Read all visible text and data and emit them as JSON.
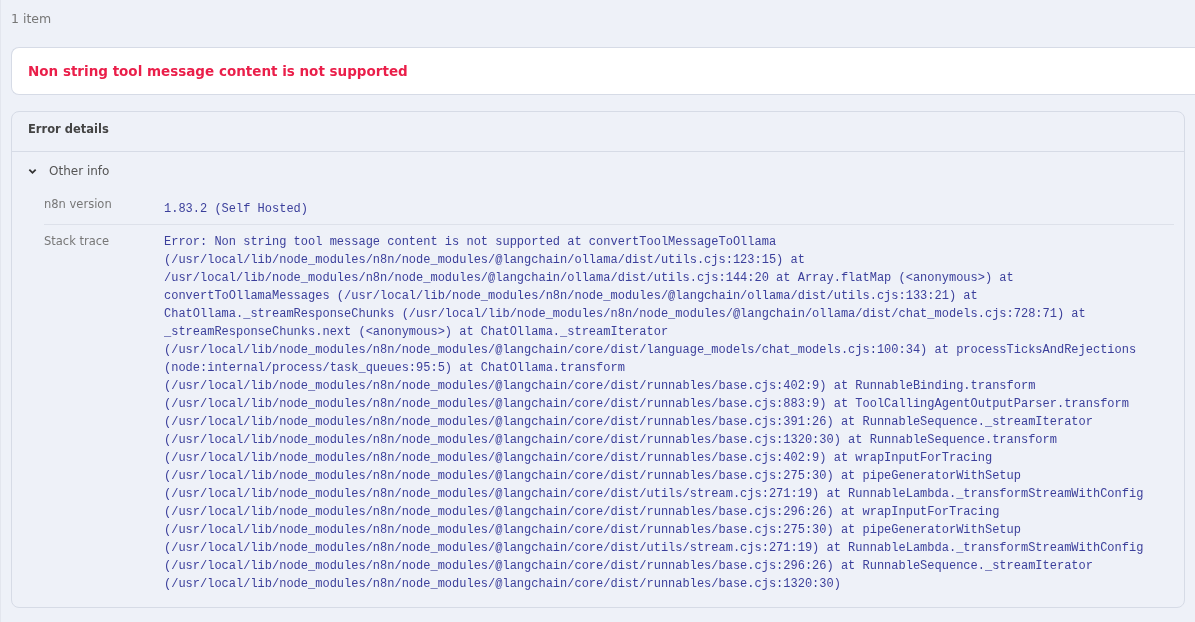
{
  "item_count": "1 item",
  "error_message": "Non string tool message content is not supported",
  "details": {
    "title": "Error details",
    "section": {
      "title": "Other info",
      "expanded": true,
      "rows": [
        {
          "label": "n8n version",
          "value": "1.83.2 (Self Hosted)"
        },
        {
          "label": "Stack trace",
          "value": "Error: Non string tool message content is not supported at convertToolMessageToOllama (/usr/local/lib/node_modules/n8n/node_modules/@langchain/ollama/dist/utils.cjs:123:15) at /usr/local/lib/node_modules/n8n/node_modules/@langchain/ollama/dist/utils.cjs:144:20 at Array.flatMap (<anonymous>) at convertToOllamaMessages (/usr/local/lib/node_modules/n8n/node_modules/@langchain/ollama/dist/utils.cjs:133:21) at ChatOllama._streamResponseChunks (/usr/local/lib/node_modules/n8n/node_modules/@langchain/ollama/dist/chat_models.cjs:728:71) at _streamResponseChunks.next (<anonymous>) at ChatOllama._streamIterator (/usr/local/lib/node_modules/n8n/node_modules/@langchain/core/dist/language_models/chat_models.cjs:100:34) at processTicksAndRejections (node:internal/process/task_queues:95:5) at ChatOllama.transform (/usr/local/lib/node_modules/n8n/node_modules/@langchain/core/dist/runnables/base.cjs:402:9) at RunnableBinding.transform (/usr/local/lib/node_modules/n8n/node_modules/@langchain/core/dist/runnables/base.cjs:883:9) at ToolCallingAgentOutputParser.transform (/usr/local/lib/node_modules/n8n/node_modules/@langchain/core/dist/runnables/base.cjs:391:26) at RunnableSequence._streamIterator (/usr/local/lib/node_modules/n8n/node_modules/@langchain/core/dist/runnables/base.cjs:1320:30) at RunnableSequence.transform (/usr/local/lib/node_modules/n8n/node_modules/@langchain/core/dist/runnables/base.cjs:402:9) at wrapInputForTracing (/usr/local/lib/node_modules/n8n/node_modules/@langchain/core/dist/runnables/base.cjs:275:30) at pipeGeneratorWithSetup (/usr/local/lib/node_modules/n8n/node_modules/@langchain/core/dist/utils/stream.cjs:271:19) at RunnableLambda._transformStreamWithConfig (/usr/local/lib/node_modules/n8n/node_modules/@langchain/core/dist/runnables/base.cjs:296:26) at wrapInputForTracing (/usr/local/lib/node_modules/n8n/node_modules/@langchain/core/dist/runnables/base.cjs:275:30) at pipeGeneratorWithSetup (/usr/local/lib/node_modules/n8n/node_modules/@langchain/core/dist/utils/stream.cjs:271:19) at RunnableLambda._transformStreamWithConfig (/usr/local/lib/node_modules/n8n/node_modules/@langchain/core/dist/runnables/base.cjs:296:26) at RunnableSequence._streamIterator (/usr/local/lib/node_modules/n8n/node_modules/@langchain/core/dist/runnables/base.cjs:1320:30)"
        }
      ]
    }
  }
}
